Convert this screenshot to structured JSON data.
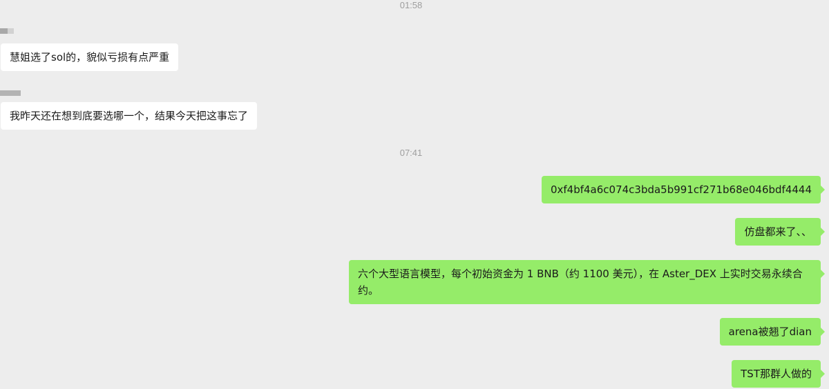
{
  "chat": {
    "timestamps": [
      "01:58",
      "07:41"
    ],
    "messages": [
      {
        "direction": "incoming",
        "text": "慧姐选了sol的，貌似亏损有点严重"
      },
      {
        "direction": "incoming",
        "text": "我昨天还在想到底要选哪一个，结果今天把这事忘了"
      },
      {
        "direction": "outgoing",
        "text": "0xf4bf4a6c074c3bda5b991cf271b68e046bdf4444"
      },
      {
        "direction": "outgoing",
        "text": "仿盘都来了、、"
      },
      {
        "direction": "outgoing",
        "text": "六个大型语言模型，每个初始资金为 1 BNB（约 1100 美元），在 Aster_DEX 上实时交易永续合约。"
      },
      {
        "direction": "outgoing",
        "text": "arena被翘了dian"
      },
      {
        "direction": "outgoing",
        "text": "TST那群人做的"
      }
    ]
  },
  "colors": {
    "background": "#ededed",
    "incoming_bubble": "#ffffff",
    "outgoing_bubble": "#95ec69",
    "timestamp_text": "#9e9e9e"
  }
}
